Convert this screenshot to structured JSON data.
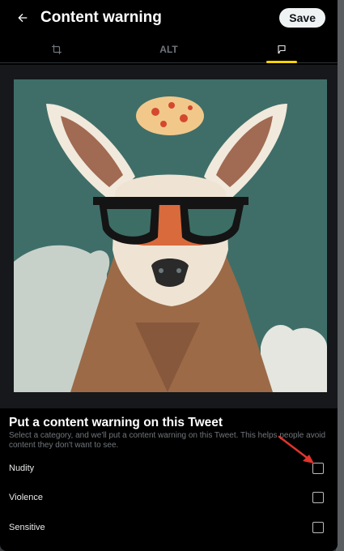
{
  "header": {
    "title": "Content warning",
    "save_label": "Save",
    "back_icon": "arrow-left-icon"
  },
  "tabs": [
    {
      "label": "",
      "icon": "crop-icon",
      "active": false
    },
    {
      "label": "ALT",
      "active": false
    },
    {
      "label": "",
      "icon": "flag-icon",
      "active": true
    }
  ],
  "info": {
    "title": "Put a content warning on this Tweet",
    "description": "Select a category, and we'll put a content warning on this Tweet. This helps people avoid content they don't want to see."
  },
  "options": [
    {
      "label": "Nudity",
      "checked": false
    },
    {
      "label": "Violence",
      "checked": false
    },
    {
      "label": "Sensitive",
      "checked": false
    }
  ],
  "colors": {
    "background": "#000000",
    "tab_indicator": "#ffd400",
    "annotation_arrow": "#e0342c"
  }
}
